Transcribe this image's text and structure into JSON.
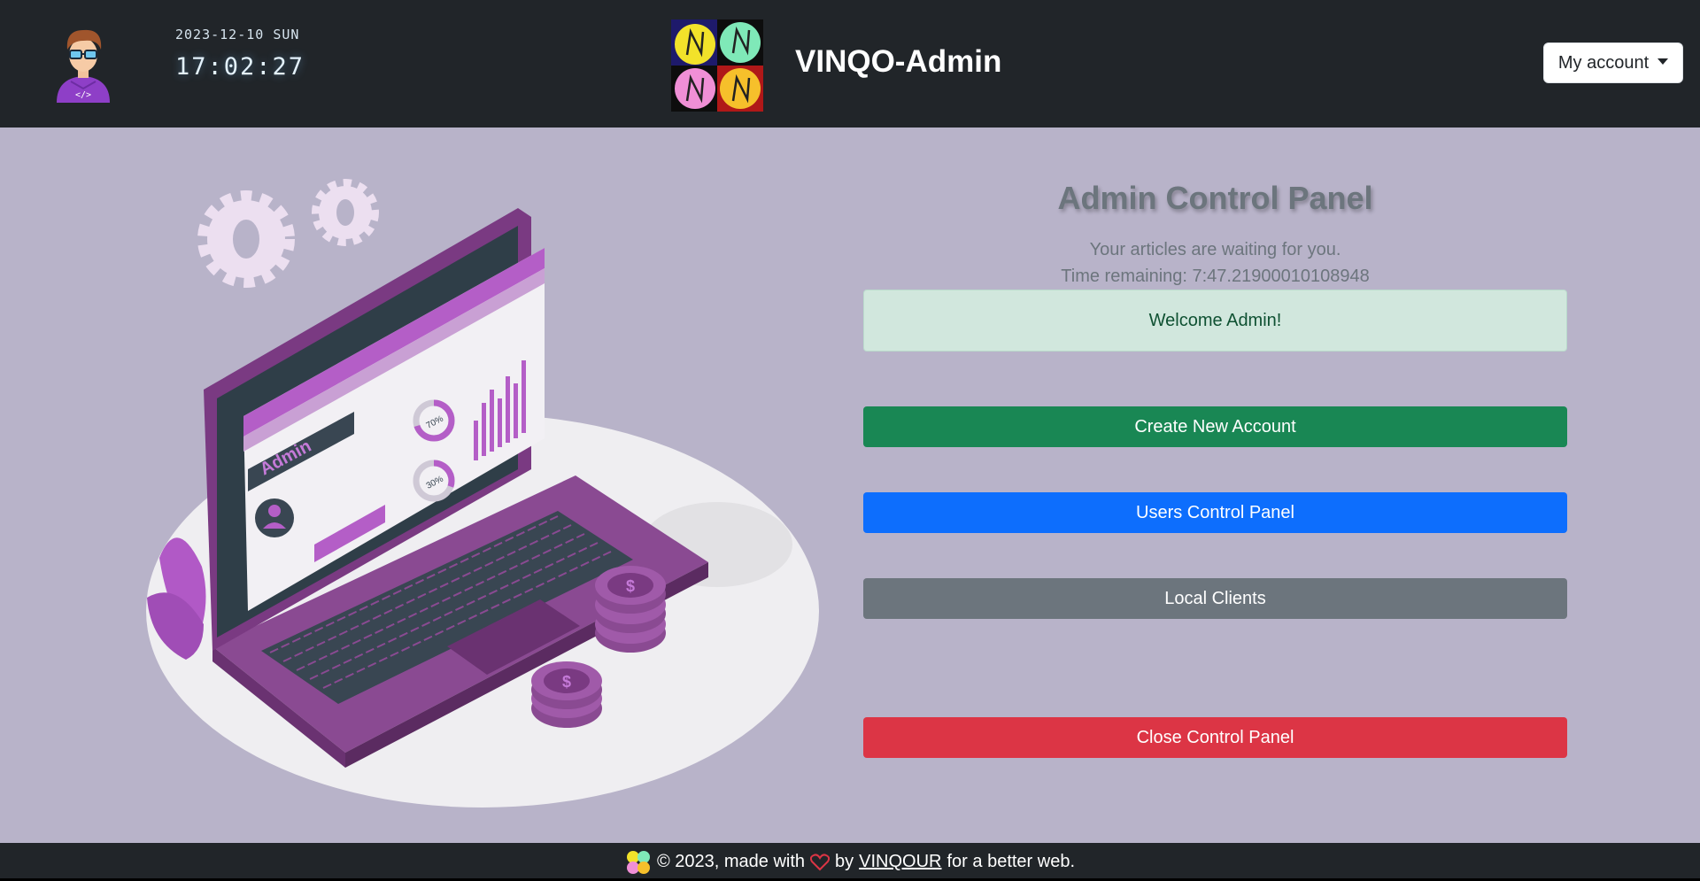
{
  "header": {
    "clock_date": "2023-12-10 SUN",
    "clock_time": "17:02:27",
    "brand": "VINQO-Admin",
    "account_label": "My account"
  },
  "main": {
    "title": "Admin Control Panel",
    "subtitle": "Your articles are waiting for you.",
    "time_remaining": "Time remaining: 7:47.21900010108948",
    "welcome": "Welcome Admin!",
    "buttons": {
      "create": "Create New Account",
      "users": "Users Control Panel",
      "local": "Local Clients",
      "close": "Close Control Panel"
    },
    "illustration_text": {
      "admin": "Admin",
      "pct_70": "70%",
      "pct_30": "30%"
    }
  },
  "footer": {
    "prefix": "© 2023, made with",
    "by": "by",
    "link": "VINQOUR",
    "suffix": "for a better web."
  },
  "colors": {
    "header_bg": "#212529",
    "page_bg": "#b8b3c9",
    "success": "#198754",
    "primary": "#0d6efd",
    "secondary": "#6c757d",
    "danger": "#dc3545",
    "alert_bg": "#d1e7dd"
  },
  "icons": [
    "developer-avatar-icon",
    "vinqo-logo-icon",
    "chevron-down-icon",
    "heart-icon",
    "vinqo-mini-logo-icon"
  ]
}
